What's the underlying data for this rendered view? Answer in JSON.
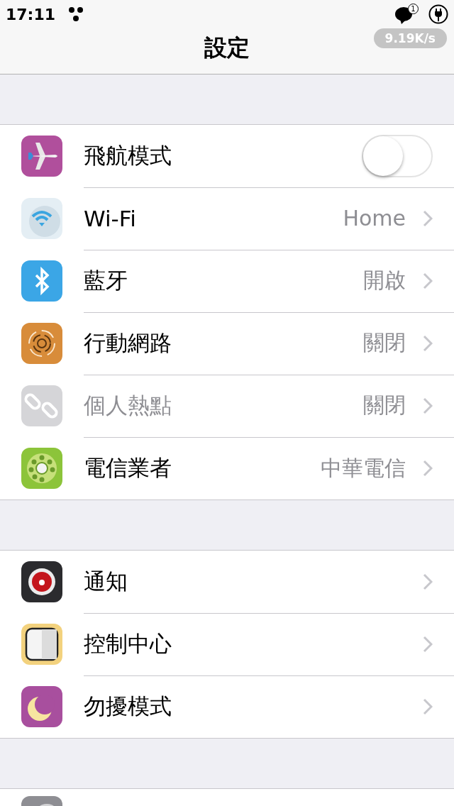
{
  "status_bar": {
    "time": "17:11",
    "notification_count": "1",
    "speed": "9.19K/s"
  },
  "nav_bar": {
    "title": "設定"
  },
  "sections": [
    {
      "items": [
        {
          "kind": "toggle",
          "label": "飛航模式",
          "on": false,
          "disabled": false
        },
        {
          "kind": "link",
          "label": "Wi-Fi",
          "value": "Home",
          "disabled": false
        },
        {
          "kind": "link",
          "label": "藍牙",
          "value": "開啟",
          "disabled": false
        },
        {
          "kind": "link",
          "label": "行動網路",
          "value": "關閉",
          "disabled": false
        },
        {
          "kind": "link",
          "label": "個人熱點",
          "value": "關閉",
          "disabled": true
        },
        {
          "kind": "link",
          "label": "電信業者",
          "value": "中華電信",
          "disabled": false
        }
      ]
    },
    {
      "items": [
        {
          "kind": "link",
          "label": "通知",
          "disabled": false
        },
        {
          "kind": "link",
          "label": "控制中心",
          "disabled": false
        },
        {
          "kind": "link",
          "label": "勿擾模式",
          "disabled": false
        }
      ]
    },
    {
      "items": [
        {
          "kind": "partial"
        }
      ]
    }
  ]
}
